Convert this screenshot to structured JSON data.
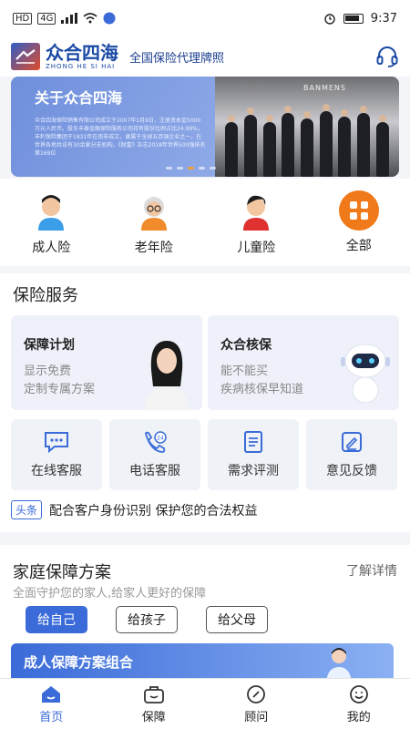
{
  "status_bar": {
    "left_icons": [
      "HD",
      "4G"
    ],
    "time": "9:37"
  },
  "header": {
    "brand_cn": "众合四海",
    "brand_en": "ZHONG HE SI HAI",
    "tagline": "全国保险代理牌照"
  },
  "banner": {
    "title": "关于众合四海",
    "text": "众合四海保险销售有限公司成立于2007年1月9日，注册资本金5000万元人民币。股东丰泰金融保险服务公司持有股份比例占比24.99%，丰利保险集团于1831年在南非成立，隶属于全球五百强企业之一，在世界各地共设有30余家分支机构。《财富》杂志2018年世界500强排名第169位",
    "photo_sign": "BANMENS",
    "slide_count": 5,
    "active_slide": 2
  },
  "categories": [
    {
      "label": "成人险",
      "icon": "adult-icon"
    },
    {
      "label": "老年险",
      "icon": "elder-icon"
    },
    {
      "label": "儿童险",
      "icon": "child-icon"
    },
    {
      "label": "全部",
      "icon": "all-icon"
    }
  ],
  "services": {
    "title": "保险服务",
    "cards": [
      {
        "title": "保障计划",
        "sub1": "显示免费",
        "sub2": "定制专属方案"
      },
      {
        "title": "众合核保",
        "sub1": "能不能买",
        "sub2": "疾病核保早知道"
      }
    ],
    "items": [
      {
        "label": "在线客服",
        "icon": "chat-icon"
      },
      {
        "label": "电话客服",
        "icon": "phone-24-icon"
      },
      {
        "label": "需求评测",
        "icon": "clipboard-icon"
      },
      {
        "label": "意见反馈",
        "icon": "feedback-edit-icon"
      }
    ],
    "news_tag": "头条",
    "news_text": "配合客户身份识别 保护您的合法权益"
  },
  "family": {
    "title": "家庭保障方案",
    "more": "了解详情",
    "subtitle": "全面守护您的家人,给家人更好的保障",
    "pills": [
      "给自己",
      "给孩子",
      "给父母"
    ],
    "active_pill": 0,
    "plan_title": "成人保障方案组合"
  },
  "nav": [
    {
      "label": "首页",
      "icon": "home-icon",
      "active": true
    },
    {
      "label": "保障",
      "icon": "shield-bag-icon",
      "active": false
    },
    {
      "label": "顾问",
      "icon": "consultant-icon",
      "active": false
    },
    {
      "label": "我的",
      "icon": "profile-icon",
      "active": false
    }
  ],
  "colors": {
    "accent": "#3a6bd8",
    "brand": "#1b4aa5",
    "highlight": "#f0a13a"
  }
}
